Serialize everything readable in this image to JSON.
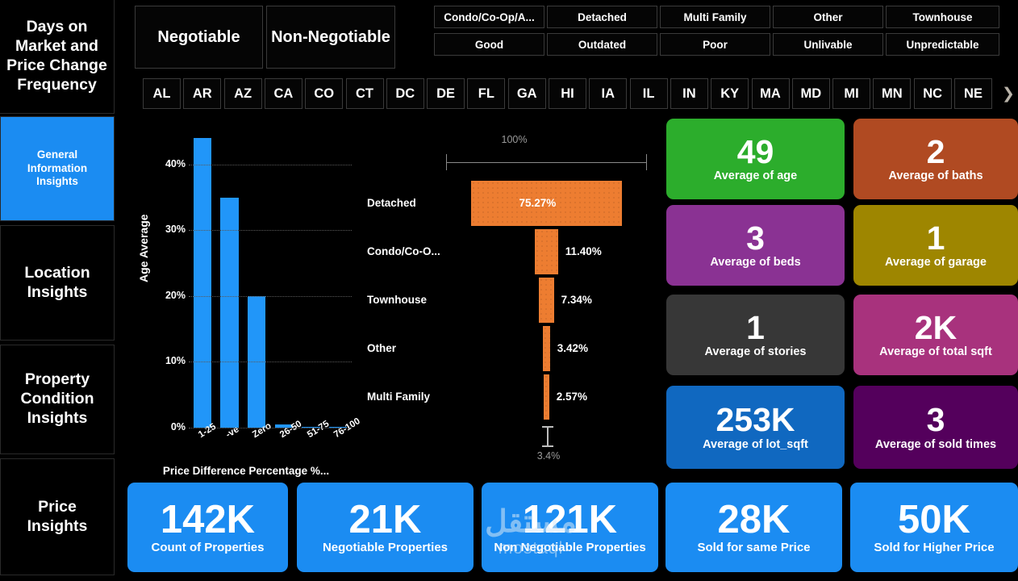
{
  "sidebar": {
    "title": "Days on Market and Price Change Frequency",
    "items": [
      {
        "label": "General Information Insights",
        "active": true
      },
      {
        "label": "Location Insights",
        "active": false
      },
      {
        "label": "Property Condition Insights",
        "active": false
      },
      {
        "label": "Price Insights",
        "active": false
      }
    ]
  },
  "filters": {
    "negotiation": [
      "Negotiable",
      "Non-Negotiable"
    ],
    "property_type": [
      "Condo/Co-Op/A...",
      "Detached",
      "Multi Family",
      "Other",
      "Townhouse"
    ],
    "condition": [
      "Good",
      "Outdated",
      "Poor",
      "Unlivable",
      "Unpredictable"
    ],
    "states": [
      "AL",
      "AR",
      "AZ",
      "CA",
      "CO",
      "CT",
      "DC",
      "DE",
      "FL",
      "GA",
      "HI",
      "IA",
      "IL",
      "IN",
      "KY",
      "MA",
      "MD",
      "MI",
      "MN",
      "NC",
      "NE"
    ],
    "states_next_icon": "chevron-right-icon"
  },
  "chart_data": [
    {
      "type": "bar",
      "title": "",
      "xlabel": "Price Difference Percentage %...",
      "ylabel": "Age Average",
      "categories": [
        "1-25",
        "-ve",
        "Zero",
        "26-50",
        "51-75",
        "76-100"
      ],
      "values": [
        44.0,
        35.0,
        20.0,
        0.5,
        0.15,
        0.1
      ],
      "ytick_labels": [
        "0%",
        "10%",
        "20%",
        "30%",
        "40%"
      ],
      "ytick_values": [
        0,
        10,
        20,
        30,
        40
      ],
      "ylim": [
        0,
        45
      ],
      "grid": true,
      "series_color": "#2196F9"
    },
    {
      "type": "funnel",
      "title": "",
      "top_label": "100%",
      "bottom_label": "3.4%",
      "categories": [
        "Detached",
        "Condo/Co-O...",
        "Townhouse",
        "Other",
        "Multi Family"
      ],
      "values": [
        75.27,
        11.4,
        7.34,
        3.42,
        2.57
      ],
      "value_labels": [
        "75.27%",
        "11.40%",
        "7.34%",
        "3.42%",
        "2.57%"
      ],
      "series_color": "#ED7D31"
    }
  ],
  "kpis": {
    "right_grid": [
      {
        "value": "49",
        "label": "Average of age",
        "color": "#2CAD2C"
      },
      {
        "value": "2",
        "label": "Average of baths",
        "color": "#B04A22"
      },
      {
        "value": "3",
        "label": "Average of beds",
        "color": "#8A3293"
      },
      {
        "value": "1",
        "label": "Average of garage",
        "color": "#9E8600"
      },
      {
        "value": "1",
        "label": "Average of stories",
        "color": "#373737"
      },
      {
        "value": "2K",
        "label": "Average of total  sqft",
        "color": "#A8327D"
      },
      {
        "value": "253K",
        "label": "Average of lot_sqft",
        "color": "#1068C0"
      },
      {
        "value": "3",
        "label": "Average of sold  times",
        "color": "#54005C"
      }
    ],
    "bottom_row": [
      {
        "value": "142K",
        "label": "Count of Properties",
        "color": "#1B8CF2"
      },
      {
        "value": "21K",
        "label": "Negotiable Properties",
        "color": "#1B8CF2"
      },
      {
        "value": "121K",
        "label": "Non Negotiable Properties",
        "color": "#1B8CF2"
      },
      {
        "value": "28K",
        "label": "Sold for same Price",
        "color": "#1B8CF2"
      },
      {
        "value": "50K",
        "label": "Sold for Higher Price",
        "color": "#1B8CF2"
      }
    ]
  },
  "watermark": {
    "arabic": "مستقل",
    "latin": "mostaql"
  }
}
